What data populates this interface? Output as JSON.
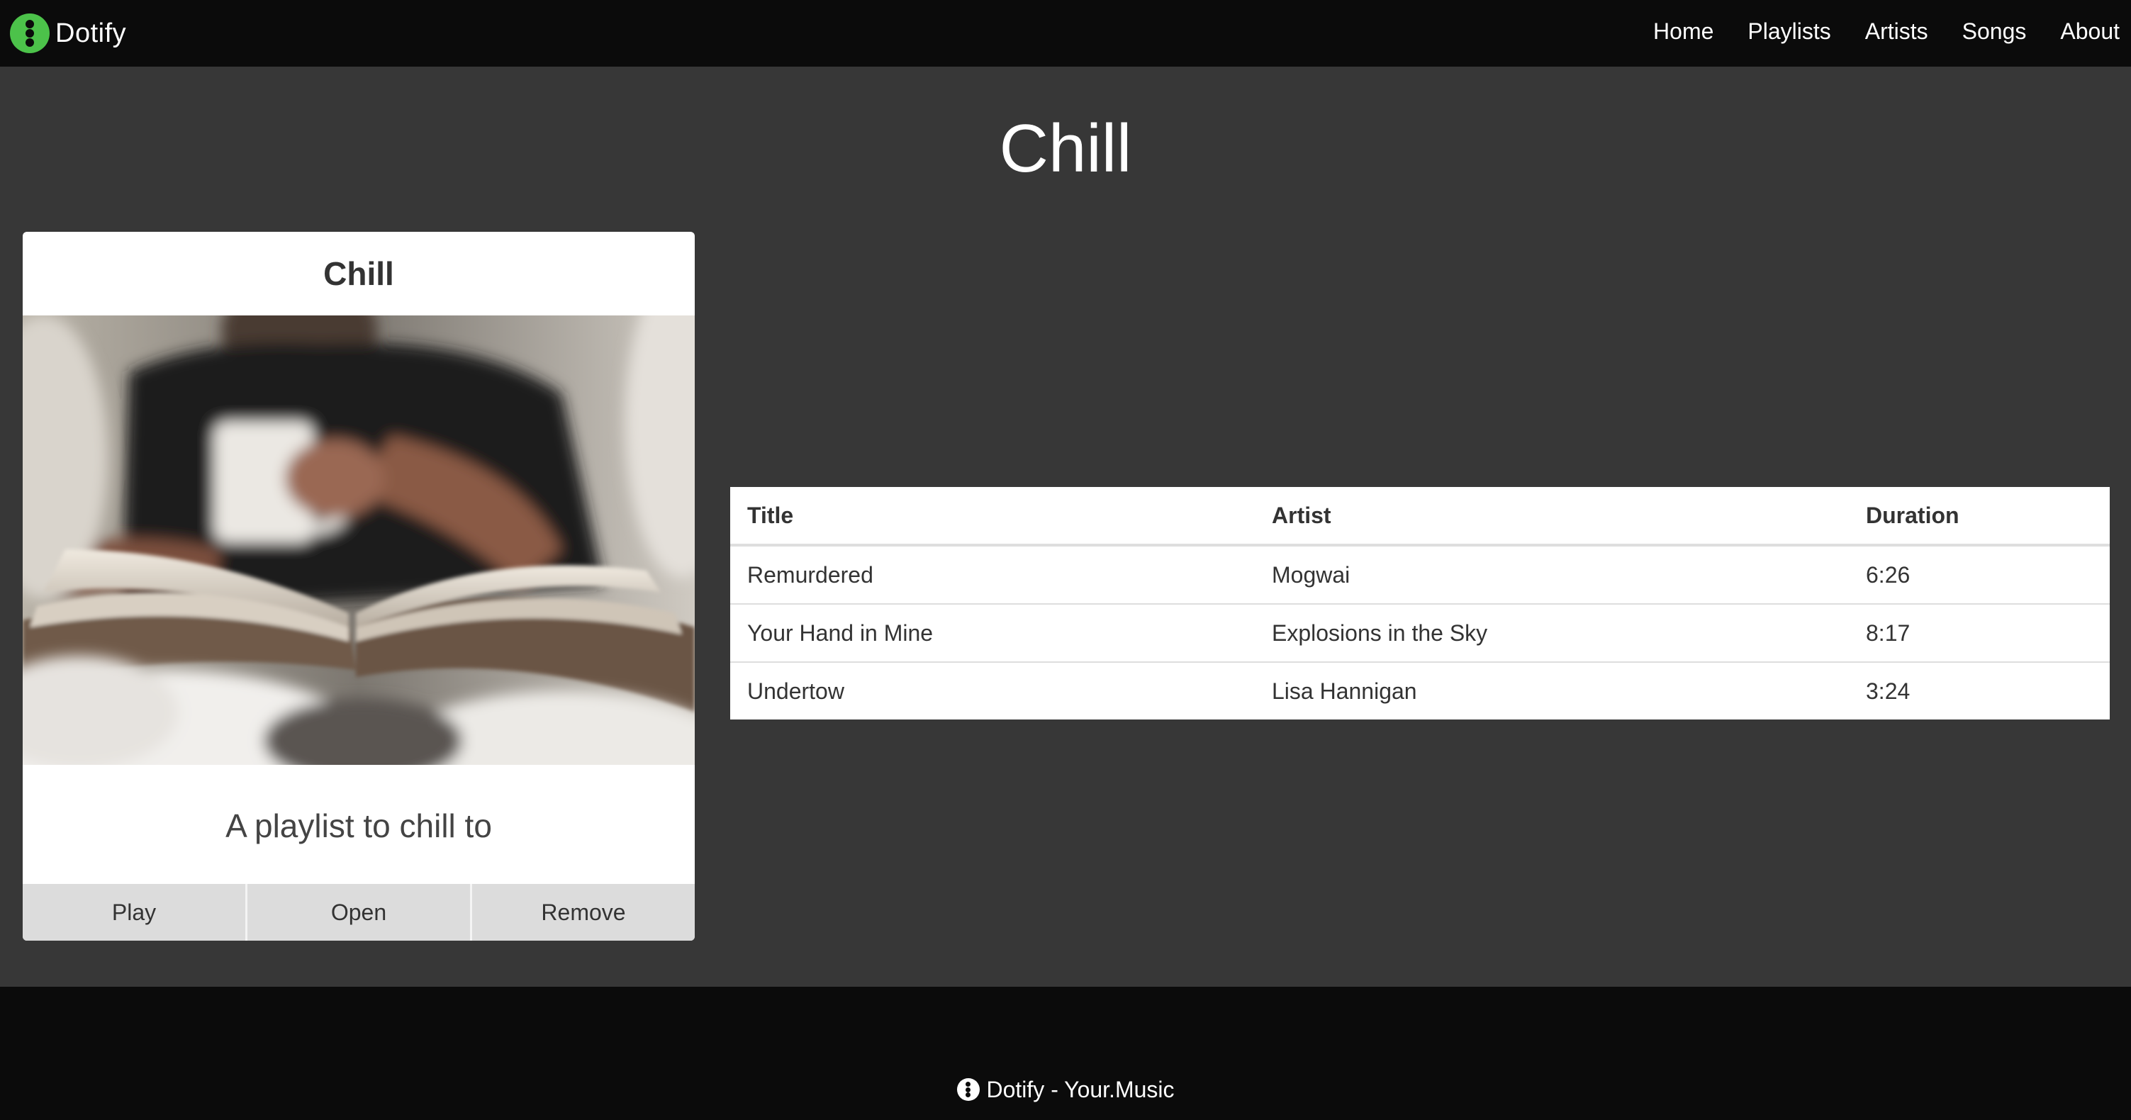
{
  "navbar": {
    "brand": "Dotify",
    "links": [
      "Home",
      "Playlists",
      "Artists",
      "Songs",
      "About"
    ]
  },
  "page": {
    "title": "Chill"
  },
  "playlist_card": {
    "title": "Chill",
    "image_subject": "person reading a book holding a mug",
    "description": "A playlist to chill to",
    "buttons": {
      "play": "Play",
      "open": "Open",
      "remove": "Remove"
    }
  },
  "songs_table": {
    "headers": {
      "title": "Title",
      "artist": "Artist",
      "duration": "Duration"
    },
    "rows": [
      {
        "title": "Remurdered",
        "artist": "Mogwai",
        "duration": "6:26"
      },
      {
        "title": "Your Hand in Mine",
        "artist": "Explosions in the Sky",
        "duration": "8:17"
      },
      {
        "title": "Undertow",
        "artist": "Lisa Hannigan",
        "duration": "3:24"
      }
    ]
  },
  "footer": {
    "text": "Dotify - Your.Music"
  },
  "colors": {
    "background": "#373737",
    "navbar": "#0b0b0b",
    "brand_accent": "#4cc24a",
    "card_button": "#dcdcdc"
  }
}
